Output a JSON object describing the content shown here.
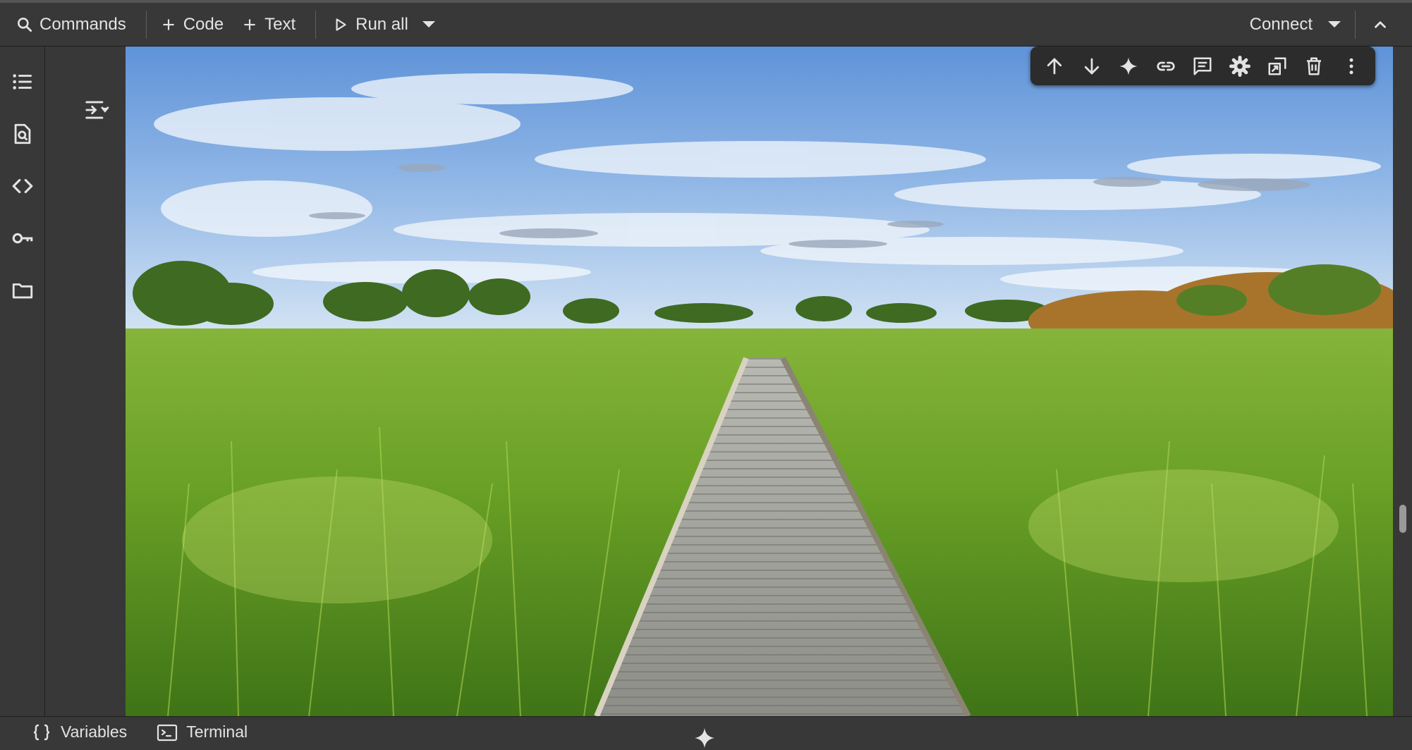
{
  "toolbar": {
    "commands_label": "Commands",
    "code_label": "Code",
    "text_label": "Text",
    "run_all_label": "Run all",
    "connect_label": "Connect"
  },
  "rail": {
    "items": [
      "table-of-contents-icon",
      "find-replace-icon",
      "code-snippets-icon",
      "secrets-key-icon",
      "files-folder-icon"
    ]
  },
  "cell_toolbar": {
    "icons": [
      "arrow-up-icon",
      "arrow-down-icon",
      "gemini-sparkle-icon",
      "link-icon",
      "comment-icon",
      "gear-icon",
      "mirror-cell-icon",
      "delete-icon",
      "more-vert-icon"
    ]
  },
  "statusbar": {
    "variables_label": "Variables",
    "terminal_label": "Terminal"
  },
  "colors": {
    "chrome_bg": "#383838",
    "text": "#e3e3e3",
    "cell_toolbar_bg": "#2c2c2c"
  }
}
